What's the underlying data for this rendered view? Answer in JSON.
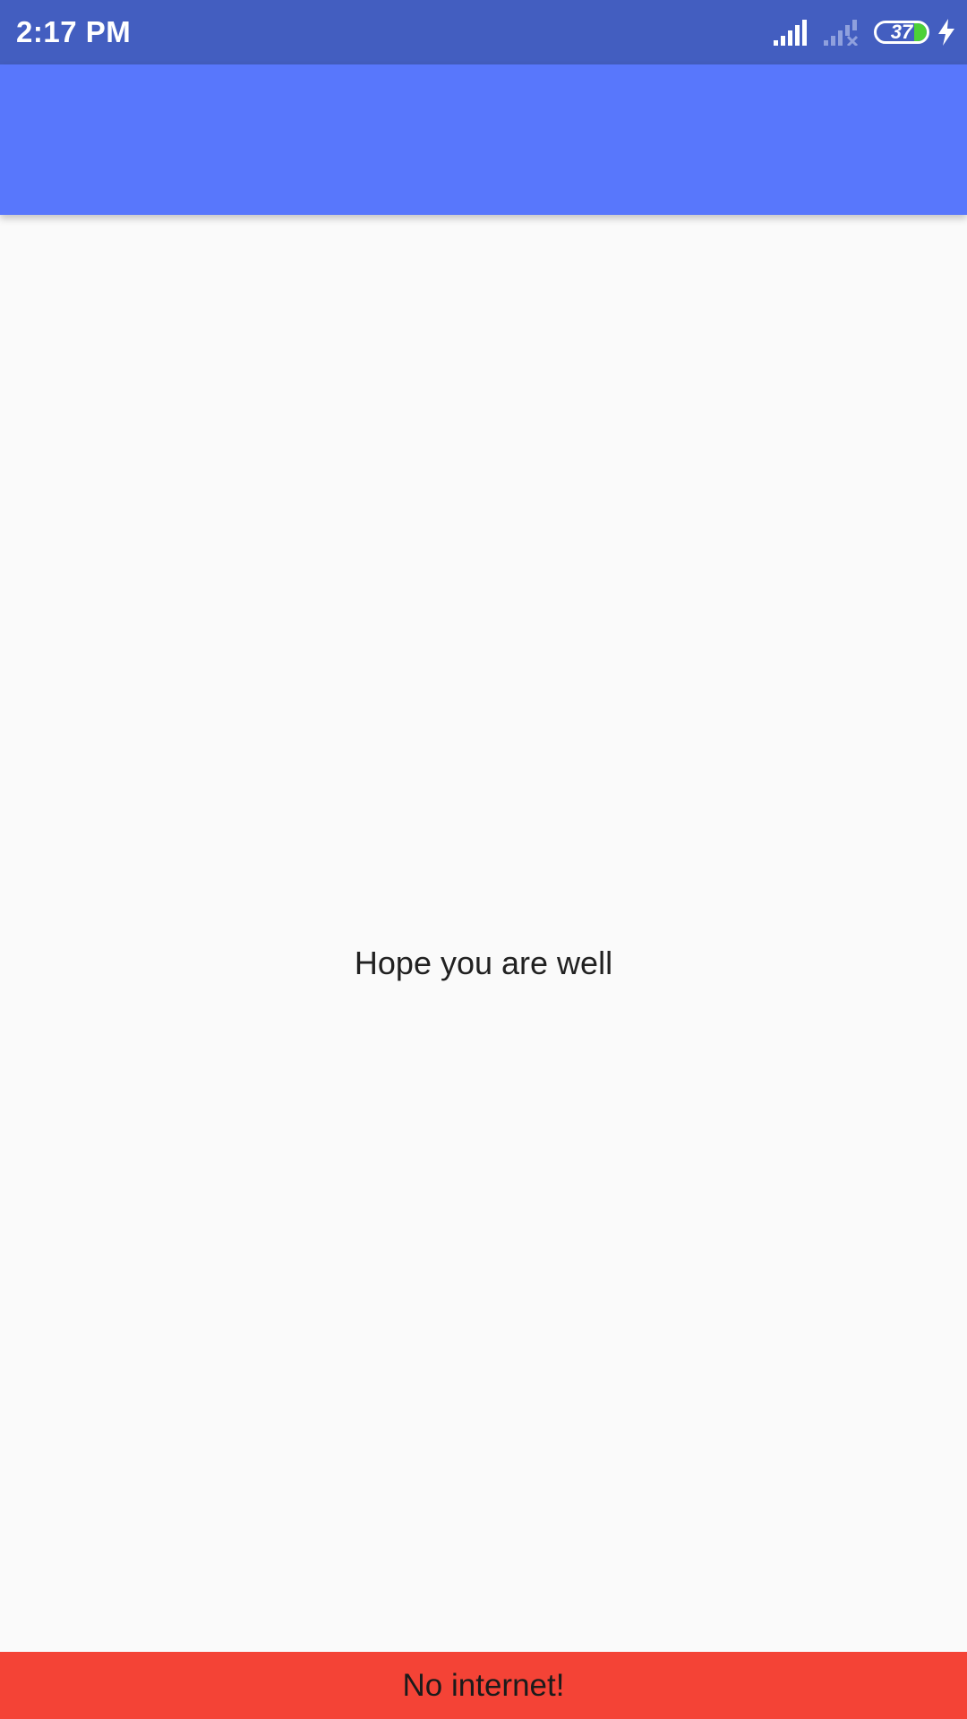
{
  "status_bar": {
    "time": "2:17 PM",
    "battery_level": "37",
    "icons": [
      "signal-full-icon",
      "signal-no-service-icon",
      "battery-icon",
      "charging-bolt-icon"
    ],
    "background_color": "#435ec0"
  },
  "app_bar": {
    "title": "",
    "background_color": "#5877fc"
  },
  "body": {
    "message": "Hope you are well"
  },
  "snackbar": {
    "message": "No internet!",
    "background_color": "#f44336"
  }
}
